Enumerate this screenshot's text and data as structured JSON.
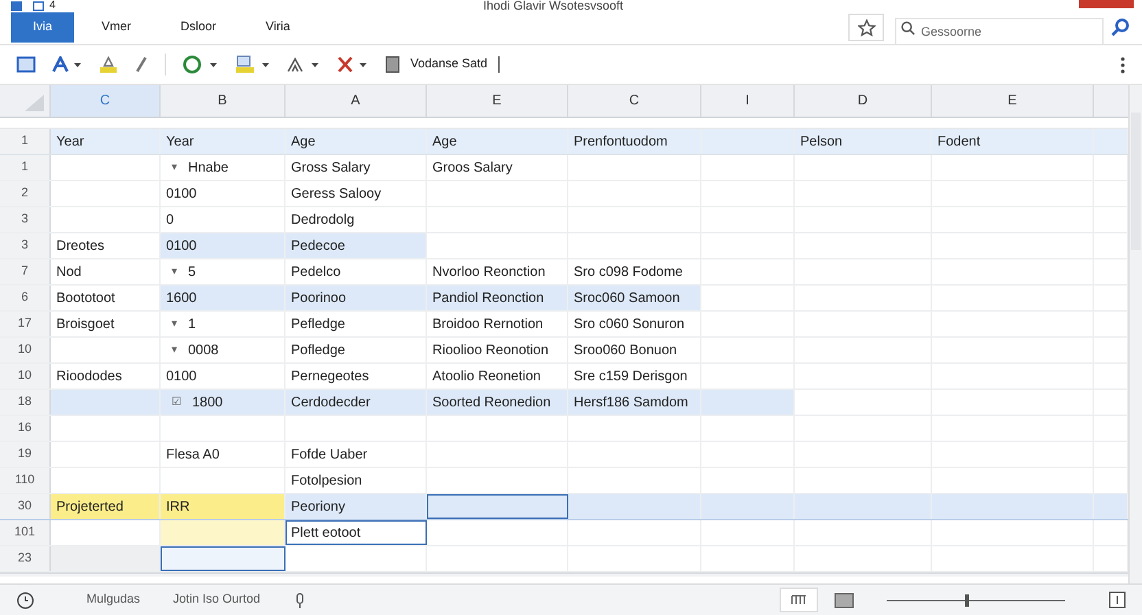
{
  "window": {
    "title": "Ihodi Glavir Wsotesvsooft",
    "quick_number": "4"
  },
  "tabs": [
    {
      "label": "Ivia",
      "selected": true
    },
    {
      "label": "Vmer",
      "selected": false
    },
    {
      "label": "Dsloor",
      "selected": false
    },
    {
      "label": "Viria",
      "selected": false
    }
  ],
  "search": {
    "placeholder": "Gessoorne"
  },
  "toolbar": {
    "font_name": "Vodanse Satd"
  },
  "columns": [
    {
      "label": "C",
      "selected": true
    },
    {
      "label": "B",
      "selected": false
    },
    {
      "label": "A",
      "selected": false
    },
    {
      "label": "E",
      "selected": false
    },
    {
      "label": "C",
      "selected": false
    },
    {
      "label": "I",
      "selected": false
    },
    {
      "label": "D",
      "selected": false
    },
    {
      "label": "E",
      "selected": false
    }
  ],
  "rows": [
    {
      "header": "1",
      "kind": "heading",
      "cells": [
        {
          "text": "Year"
        },
        {
          "text": "Year"
        },
        {
          "text": "Age"
        },
        {
          "text": "Age"
        },
        {
          "text": "Prenfontuodom"
        },
        null,
        {
          "text": "Pelson"
        },
        {
          "text": "Fodent"
        }
      ]
    },
    {
      "header": "1",
      "cells": [
        null,
        {
          "marker": "▾",
          "text": "Hnabe"
        },
        {
          "text": "Gross Salary"
        },
        {
          "text": "Groos Salary"
        }
      ]
    },
    {
      "header": "2",
      "cells": [
        null,
        {
          "text": "0100"
        },
        {
          "text": "Geress Salooy"
        }
      ]
    },
    {
      "header": "3",
      "cells": [
        null,
        {
          "text": "0"
        },
        {
          "text": "Dedrodolg"
        }
      ]
    },
    {
      "header": "3",
      "cells": [
        {
          "text": "Dreotes"
        },
        {
          "text": "0100",
          "color": "#dde9f8"
        },
        {
          "text": "Pedecoe",
          "color": "#dde9f8"
        }
      ]
    },
    {
      "header": "7",
      "cells": [
        {
          "text": "Nod"
        },
        {
          "marker": "▾",
          "text": "5"
        },
        {
          "text": "Pedelco"
        },
        {
          "text": "Nvorloo Reonction"
        },
        {
          "text": "Sro c098 Fodome"
        }
      ]
    },
    {
      "header": "6",
      "cells": [
        {
          "text": "Boototoot"
        },
        {
          "text": "1600",
          "color": "#dde9f8"
        },
        {
          "text": "Poorinoo",
          "color": "#dde9f8"
        },
        {
          "text": "Pandiol Reonction",
          "color": "#dde9f8"
        },
        {
          "text": "Sroc060 Samoon",
          "color": "#dde9f8"
        }
      ]
    },
    {
      "header": "17",
      "cells": [
        {
          "text": "Broisgoet"
        },
        {
          "marker": "▾",
          "text": "1"
        },
        {
          "text": "Pefledge"
        },
        {
          "text": "Broidoo Rernotion"
        },
        {
          "text": "Sro c060 Sonuron"
        }
      ]
    },
    {
      "header": "10",
      "cells": [
        null,
        {
          "marker": "▾",
          "text": "0008"
        },
        {
          "text": "Pofledge"
        },
        {
          "text": "Rioolioo Reonotion"
        },
        {
          "text": "Sroo060 Bonuon"
        }
      ]
    },
    {
      "header": "10",
      "cells": [
        {
          "text": "Rioododes"
        },
        {
          "text": "0100"
        },
        {
          "text": "Pernegeotes"
        },
        {
          "text": "Atoolio Reonetion"
        },
        {
          "text": "Sre c159 Derisgon"
        }
      ]
    },
    {
      "header": "18",
      "cells": [
        {
          "color": "#dde9f8"
        },
        {
          "marker": "☑",
          "text": "1800",
          "color": "#dde9f8"
        },
        {
          "text": "Cerdodecder",
          "color": "#dde9f8"
        },
        {
          "text": "Soorted Reonedion",
          "color": "#dde9f8"
        },
        {
          "text": "Hersf186 Samdom",
          "color": "#dde9f8"
        },
        {
          "color": "#dde9f8"
        }
      ]
    },
    {
      "header": "16",
      "cells": []
    },
    {
      "header": "19",
      "cells": [
        null,
        {
          "text": "Flesa A0"
        },
        {
          "text": "Fofde Uaber"
        }
      ]
    },
    {
      "header": "110",
      "cells": [
        null,
        null,
        {
          "text": "Fotolpesion"
        }
      ]
    },
    {
      "header": "30",
      "kind": "selected",
      "cells": [
        {
          "text": "Projeterted",
          "color": "#fbee8a"
        },
        {
          "text": "IRR",
          "color": "#fbee8a"
        },
        {
          "text": "Peoriony",
          "color": "#dde9f8"
        },
        {
          "color": "#dde9f8",
          "outlined": true
        },
        {
          "color": "#dde9f8"
        },
        {
          "color": "#dde9f8"
        },
        {
          "color": "#dde9f8"
        },
        {
          "color": "#dde9f8"
        }
      ]
    },
    {
      "header": "101",
      "cells": [
        null,
        {
          "color": "#fdf6c8"
        },
        {
          "text": "Plett eotoot",
          "outlined": true
        }
      ]
    },
    {
      "header": "23",
      "cells": [
        {
          "color": "#eeeff1"
        },
        {
          "outlined": true,
          "color": "#eef4fc"
        }
      ]
    }
  ],
  "status_bar": {
    "items": [
      "Mulgudas",
      "Jotin Iso Ourtod"
    ],
    "zoom": {
      "level": 0.45
    }
  }
}
